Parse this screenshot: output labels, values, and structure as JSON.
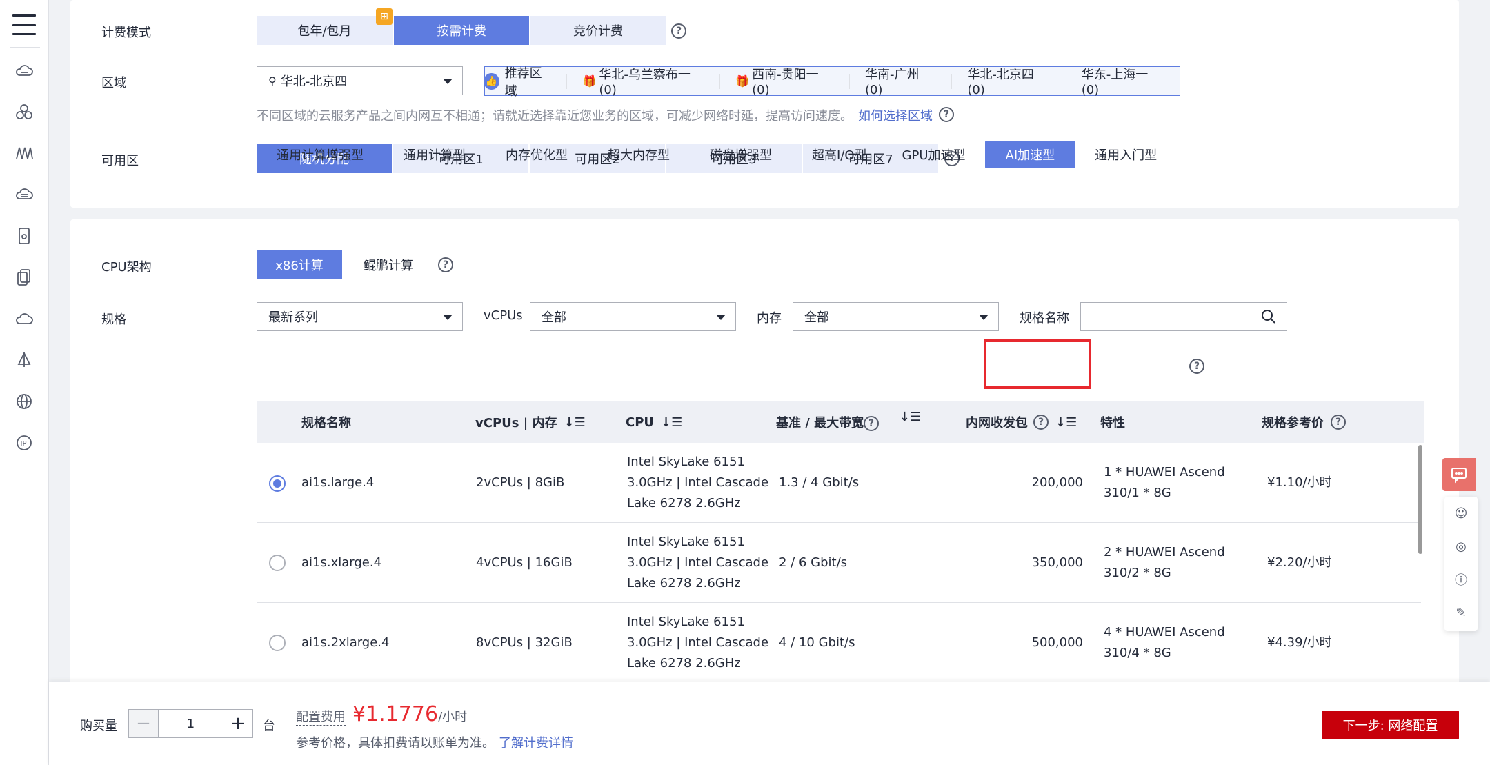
{
  "billing": {
    "label": "计费模式",
    "options": [
      "包年/包月",
      "按需计费",
      "竞价计费"
    ],
    "active_index": 1
  },
  "region": {
    "label": "区域",
    "selected": "华北-北京四",
    "recommend_label": "推荐区域",
    "recommend": [
      "华北-乌兰察布一 (0)",
      "西南-贵阳一 (0)",
      "华南-广州 (0)",
      "华北-北京四 (0)",
      "华东-上海一 (0)"
    ],
    "hint": "不同区域的云服务产品之间内网互不相通；请就近选择靠近您业务的区域，可减少网络时延，提高访问速度。",
    "hint_link": "如何选择区域"
  },
  "az": {
    "label": "可用区",
    "options": [
      "随机分配",
      "可用区1",
      "可用区2",
      "可用区3",
      "可用区7"
    ],
    "active_index": 0
  },
  "cpu_arch": {
    "label": "CPU架构",
    "options": [
      "x86计算",
      "鲲鹏计算"
    ],
    "active_index": 0
  },
  "spec": {
    "label": "规格",
    "series_selected": "最新系列",
    "vcpus_label": "vCPUs",
    "vcpus_selected": "全部",
    "memory_label": "内存",
    "memory_selected": "全部",
    "name_label": "规格名称",
    "name_placeholder": ""
  },
  "type_tabs": [
    "通用计算增强型",
    "通用计算型",
    "内存优化型",
    "超大内存型",
    "磁盘增强型",
    "超高I/O型",
    "GPU加速型",
    "AI加速型",
    "通用入门型"
  ],
  "type_active_index": 7,
  "table": {
    "headers": {
      "name": "规格名称",
      "vcpu_mem": "vCPUs | 内存",
      "cpu": "CPU",
      "bandwidth": "基准 / 最大带宽",
      "pps": "内网收发包",
      "feature": "特性",
      "price": "规格参考价"
    },
    "rows": [
      {
        "selected": true,
        "name": "ai1s.large.4",
        "vcpu_mem": "2vCPUs | 8GiB",
        "cpu": [
          "Intel SkyLake 6151",
          "3.0GHz | Intel Cascade",
          "Lake 6278 2.6GHz"
        ],
        "bandwidth": "1.3 / 4 Gbit/s",
        "pps": "200,000",
        "feature": [
          "1 * HUAWEI Ascend",
          "310/1 * 8G"
        ],
        "price": "¥1.10/小时"
      },
      {
        "selected": false,
        "name": "ai1s.xlarge.4",
        "vcpu_mem": "4vCPUs | 16GiB",
        "cpu": [
          "Intel SkyLake 6151",
          "3.0GHz | Intel Cascade",
          "Lake 6278 2.6GHz"
        ],
        "bandwidth": "2 / 6 Gbit/s",
        "pps": "350,000",
        "feature": [
          "2 * HUAWEI Ascend",
          "310/2 * 8G"
        ],
        "price": "¥2.20/小时"
      },
      {
        "selected": false,
        "name": "ai1s.2xlarge.4",
        "vcpu_mem": "8vCPUs | 32GiB",
        "cpu": [
          "Intel SkyLake 6151",
          "3.0GHz | Intel Cascade",
          "Lake 6278 2.6GHz"
        ],
        "bandwidth": "4 / 10 Gbit/s",
        "pps": "500,000",
        "feature": [
          "4 * HUAWEI Ascend",
          "310/4 * 8G"
        ],
        "price": "¥4.39/小时"
      }
    ]
  },
  "bottom": {
    "qty_label": "购买量",
    "qty_value": "1",
    "qty_unit": "台",
    "price_label": "配置费用",
    "price_value": "¥1.1776",
    "price_unit": "/小时",
    "price_note": "参考价格，具体扣费请以账单为准。",
    "price_link": "了解计费详情",
    "next_label": "下一步: 网络配置"
  },
  "colors": {
    "accent": "#5e7ce0",
    "primary_action": "#c7000b",
    "price": "#e7292f",
    "highlight_box": "#e7292f"
  }
}
